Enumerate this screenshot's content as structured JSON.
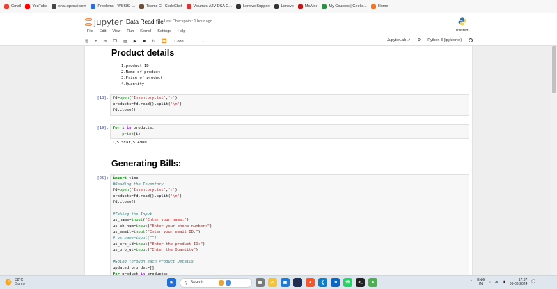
{
  "bookmarks": [
    {
      "label": "Gmail",
      "color": "#ea4335"
    },
    {
      "label": "YouTube",
      "color": "#ff0000"
    },
    {
      "label": "chat.openai.com",
      "color": "#444444"
    },
    {
      "label": "Problems - WSSIS -...",
      "color": "#2d6cdf"
    },
    {
      "label": "Teams C - CodeChef",
      "color": "#6b4f3a"
    },
    {
      "label": "Volumes A2V DSA C...",
      "color": "#d33"
    },
    {
      "label": "Lenovo Support",
      "color": "#333333"
    },
    {
      "label": "Lenovo",
      "color": "#333333"
    },
    {
      "label": "McAfee",
      "color": "#c01818"
    },
    {
      "label": "My Courses | Geeks...",
      "color": "#2f8d46"
    },
    {
      "label": "Home",
      "color": "#f37626"
    }
  ],
  "jupyter": {
    "logo_text": "jupyter",
    "notebook_title": "Data Read file",
    "checkpoint": "Last Checkpoint: 1 hour ago",
    "trusted": "Trusted",
    "menu": [
      "File",
      "Edit",
      "View",
      "Run",
      "Kernel",
      "Settings",
      "Help"
    ],
    "cell_type": "Code",
    "jupyterlab_link": "JupyterLab",
    "kernel_name": "Python 3 (ipykernel)"
  },
  "notebook": {
    "heading1": "Product details",
    "list_items": [
      "1.product ID",
      "2.Name of product",
      "3.Price of product",
      "4.Quantity"
    ],
    "cell1_prompt": "[18]:",
    "cell1_lines": [
      "fd=open('Inventory.txt','r')",
      "products=fd.read().split('\\n')",
      "fd.close()"
    ],
    "cell2_prompt": "[19]:",
    "cell2_lines": [
      "for i in products:",
      "    print(i)"
    ],
    "cell2_output": "1,5 Star,5,4980",
    "heading2": "Generating Bills:",
    "cell3_prompt": "[25]:",
    "cell3_lines": [
      "import time",
      "#Reading the Inventory",
      "fd=open('Inventory.txt','r')",
      "products=fd.read().split('\\n')",
      "fd.close()",
      "",
      "#Taking the Input",
      "us_name=input(\"Enter your name:\")",
      "us_ph_num=input(\"Enter your phone number:\")",
      "us_email=input(\"Enter your email ID:\")",
      "# us_name=input(\"\")",
      "us_pro_id=input(\"Enter the product ID:\")",
      "us_pro_qt=input(\"Enter the Quantity\")",
      "",
      "#Going through each Product Details",
      "updated_pro_det=[]",
      "for product in products:"
    ]
  },
  "taskbar": {
    "temperature": "38°C",
    "weather": "Sunny",
    "search_placeholder": "Search",
    "lang_top": "ENG",
    "lang_bottom": "IN",
    "time": "17:37",
    "date": "06-06-2024"
  }
}
